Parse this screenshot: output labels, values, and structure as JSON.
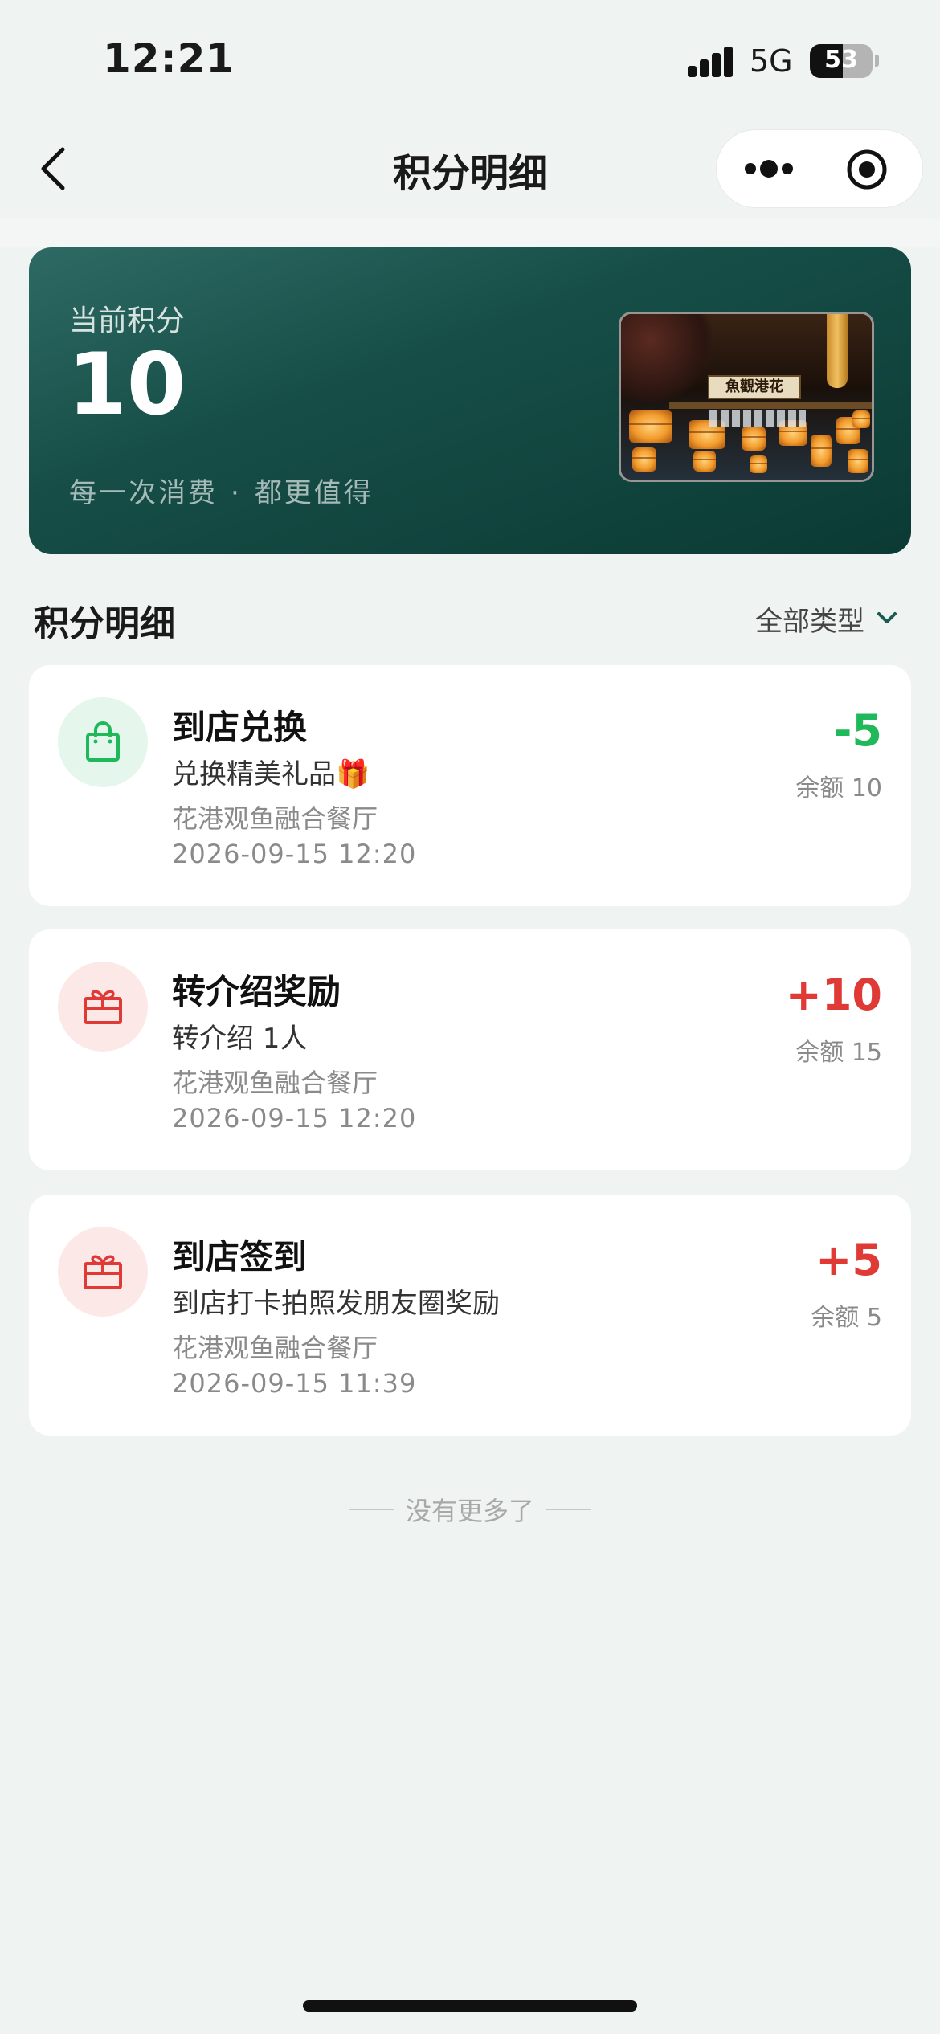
{
  "status_bar": {
    "time": "12:21",
    "network": "5G",
    "battery": "53",
    "battery_level_percent": 53
  },
  "nav": {
    "title": "积分明细",
    "icons": {
      "back": "chevron-left-icon",
      "more": "more-dots-icon",
      "close": "target-circle-icon"
    }
  },
  "points_card": {
    "label": "当前积分",
    "value": "10",
    "slogan_left": "每一次消费",
    "slogan_dot": "·",
    "slogan_right": "都更值得",
    "photo_sign": "魚觀港花",
    "colors": {
      "gradient_start": "#2e6a64",
      "gradient_end": "#0b3a34"
    }
  },
  "section": {
    "title": "积分明细",
    "filter_label": "全部类型"
  },
  "records": [
    {
      "title": "到店兑换",
      "desc": "兑换精美礼品🎁",
      "store": "花港观鱼融合餐厅",
      "time": "2026-09-15 12:20",
      "amount": "-5",
      "balance": "余额 10",
      "icon": "shopping-bag-icon",
      "type": "minus"
    },
    {
      "title": "转介绍奖励",
      "desc": "转介绍 1人",
      "store": "花港观鱼融合餐厅",
      "time": "2026-09-15 12:20",
      "amount": "+10",
      "balance": "余额 15",
      "icon": "gift-box-icon",
      "type": "plus"
    },
    {
      "title": "到店签到",
      "desc": "到店打卡拍照发朋友圈奖励",
      "store": "花港观鱼融合餐厅",
      "time": "2026-09-15 11:39",
      "amount": "+5",
      "balance": "余额 5",
      "icon": "gift-box-icon",
      "type": "plus"
    }
  ],
  "footer": {
    "end_text": "没有更多了"
  },
  "colors": {
    "background": "#eff3f2",
    "minus": "#1fb85a",
    "plus": "#e03a36"
  }
}
